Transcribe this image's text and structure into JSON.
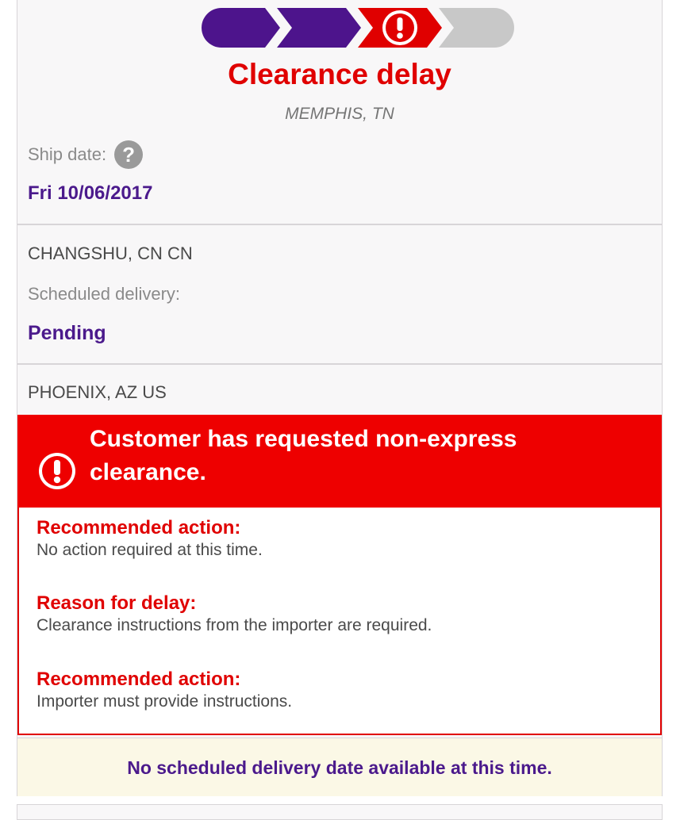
{
  "tracker": {
    "progress_steps": [
      {
        "state": "complete",
        "color": "#4d148c"
      },
      {
        "state": "complete",
        "color": "#4d148c"
      },
      {
        "state": "exception",
        "color": "#e00000",
        "icon": "exclamation-icon"
      },
      {
        "state": "pending",
        "color": "#c8c8c8"
      }
    ],
    "status_title": "Clearance delay",
    "status_location": "MEMPHIS, TN",
    "ship_date_label": "Ship date:",
    "help_icon": "?",
    "ship_date": "Fri 10/06/2017",
    "origin": "CHANGSHU, CN CN",
    "scheduled_delivery_label": "Scheduled delivery:",
    "scheduled_delivery_value": "Pending",
    "destination": "PHOENIX, AZ US"
  },
  "alert": {
    "icon": "exclamation-icon",
    "header": "Customer has requested non-express clearance.",
    "items": [
      {
        "label": "Recommended action:",
        "text": "No action required at this time."
      },
      {
        "label": "Reason for delay:",
        "text": "Clearance instructions from the importer are required."
      },
      {
        "label": "Recommended action:",
        "text": "Importer must provide instructions."
      }
    ]
  },
  "notice": "No scheduled delivery date available at this time.",
  "colors": {
    "brand_purple": "#4d148c",
    "alert_red": "#ee0000",
    "pending_gray": "#c8c8c8",
    "notice_bg": "#fbf8e6"
  }
}
